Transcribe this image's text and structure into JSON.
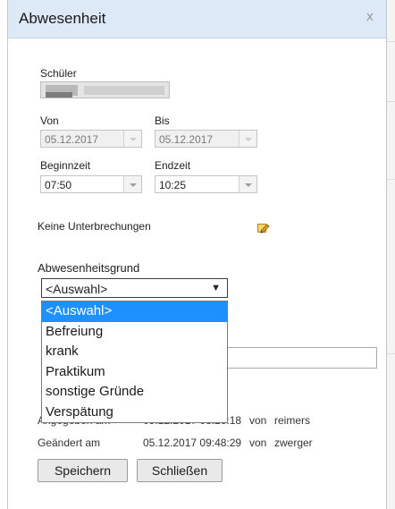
{
  "dialog": {
    "title": "Abwesenheit",
    "close_glyph": "x"
  },
  "form": {
    "schueler_label": "Schüler",
    "von_label": "Von",
    "bis_label": "Bis",
    "von_value": "05.12.2017",
    "bis_value": "05.12.2017",
    "beginn_label": "Beginnzeit",
    "end_label": "Endzeit",
    "beginn_value": "07:50",
    "end_value": "10:25",
    "interruptions_text": "Keine Unterbrechungen",
    "reason_label": "Abwesenheitsgrund",
    "reason_value": "<Auswahl>",
    "reason_arrow": "▼",
    "reason_options": [
      "<Auswahl>",
      "Befreiung",
      "krank",
      "Praktikum",
      "sonstige Gründe",
      "Verspätung"
    ]
  },
  "meta": {
    "created_label": "Angegeben am",
    "created_value": "05.12.2017 08:26:18",
    "created_by_prefix": "von",
    "created_by": "reimers",
    "changed_label": "Geändert am",
    "changed_value": "05.12.2017 09:48:29",
    "changed_by_prefix": "von",
    "changed_by": "zwerger"
  },
  "buttons": {
    "save": "Speichern",
    "close": "Schließen"
  },
  "icons": {
    "edit": "pencil-edit-icon",
    "close": "close-icon"
  }
}
